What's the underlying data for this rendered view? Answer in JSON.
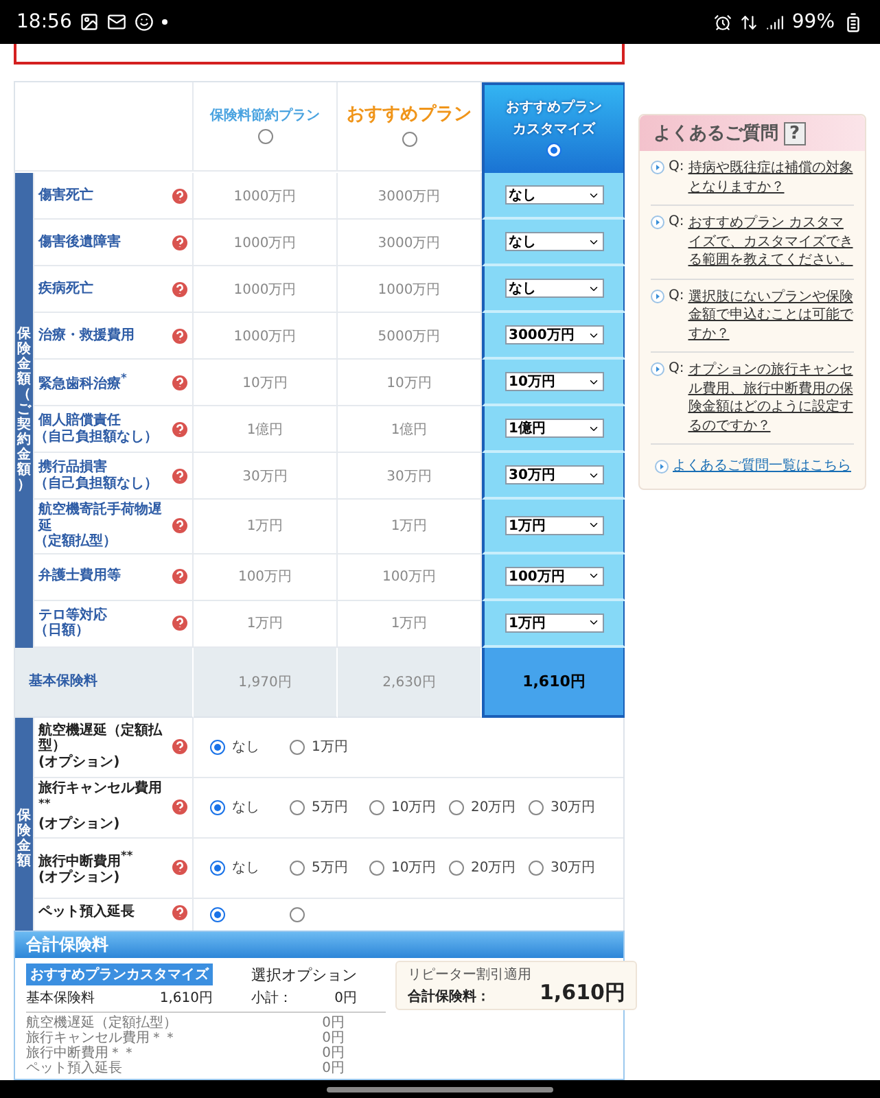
{
  "status_bar": {
    "time": "18:56",
    "battery": "99%"
  },
  "plans": [
    {
      "name": "保険料節約プラン",
      "kind": "fixed",
      "selected": false
    },
    {
      "name": "おすすめプラン",
      "kind": "fixed",
      "selected": false
    },
    {
      "name": "おすすめプラン",
      "subtitle": "カスタマイズ",
      "kind": "custom",
      "selected": true
    }
  ],
  "coverage": {
    "section_label": "保険金額（ご契約金額）",
    "rows": [
      {
        "label": "傷害死亡",
        "values": [
          "1000万円",
          "3000万円",
          "なし"
        ]
      },
      {
        "label": "傷害後遺障害",
        "values": [
          "1000万円",
          "3000万円",
          "なし"
        ]
      },
      {
        "label": "疾病死亡",
        "values": [
          "1000万円",
          "1000万円",
          "なし"
        ]
      },
      {
        "label": "治療・救援費用",
        "values": [
          "1000万円",
          "5000万円",
          "3000万円"
        ]
      },
      {
        "label": "緊急歯科治療$^{*}$",
        "values": [
          "10万円",
          "10万円",
          "10万円"
        ]
      },
      {
        "label": "個人賠償責任",
        "note": "（自己負担額なし）",
        "values": [
          "1億円",
          "1億円",
          "1億円"
        ]
      },
      {
        "label": "携行品損害",
        "note": "（自己負担額なし）",
        "values": [
          "30万円",
          "30万円",
          "30万円"
        ]
      },
      {
        "label": "航空機寄託手荷物遅延",
        "note": "（定額払型）",
        "values": [
          "1万円",
          "1万円",
          "1万円"
        ]
      },
      {
        "label": "弁護士費用等",
        "values": [
          "100万円",
          "100万円",
          "100万円"
        ]
      },
      {
        "label": "テロ等対応",
        "note": "（日額）",
        "values": [
          "1万円",
          "1万円",
          "1万円"
        ]
      }
    ]
  },
  "basic_premium": {
    "label": "基本保険料",
    "values": [
      "1,970円",
      "2,630円",
      "1,610円"
    ]
  },
  "options": {
    "section_label": "保険金額",
    "rows": [
      {
        "label": "航空機遅延（定額払型）",
        "tag": "(オプション)",
        "choices": [
          {
            "label": "なし",
            "selected": true
          },
          {
            "label": "1万円",
            "selected": false
          }
        ]
      },
      {
        "label": "旅行キャンセル費用$^{**}$",
        "tag": "(オプション)",
        "choices": [
          {
            "label": "なし",
            "selected": true
          },
          {
            "label": "5万円",
            "selected": false
          },
          {
            "label": "10万円",
            "selected": false
          },
          {
            "label": "20万円",
            "selected": false
          },
          {
            "label": "30万円",
            "selected": false
          }
        ]
      },
      {
        "label": "旅行中断費用$^{**}$",
        "tag": "(オプション)",
        "choices": [
          {
            "label": "なし",
            "selected": true
          },
          {
            "label": "5万円",
            "selected": false
          },
          {
            "label": "10万円",
            "selected": false
          },
          {
            "label": "20万円",
            "selected": false
          },
          {
            "label": "30万円",
            "selected": false
          }
        ]
      },
      {
        "label": "ペット預入延長",
        "choices": [
          {
            "selected": true
          },
          {
            "selected": false
          }
        ]
      }
    ]
  },
  "faq": {
    "title": "よくあるご質問",
    "title_icon": "?",
    "items": [
      {
        "prefix": "Q:",
        "question": "持病や既往症は補償の対象となりますか？"
      },
      {
        "prefix": "Q:",
        "question": "おすすめプラン カスタマイズで、カスタマイズできる範囲を教えてください。"
      },
      {
        "prefix": "Q:",
        "question": "選択肢にないプランや保険金額で申込むことは可能ですか？"
      },
      {
        "prefix": "Q:",
        "question": "オプションの旅行キャンセル費用、旅行中断費用の保険金額はどのように設定するのですか？"
      }
    ],
    "more_link": "よくあるご質問一覧はこちら"
  },
  "total": {
    "title": "合計保険料",
    "plan_badge": "おすすめプランカスタマイズ",
    "basic_label": "基本保険料",
    "basic_value": "1,610円",
    "options_label": "選択オプション",
    "subtotal_label": "小計：",
    "subtotal_value": "0円",
    "discount_note": "リピーター割引適用",
    "total_label": "合計保険料：",
    "total_value": "1,610円",
    "breakdown": [
      {
        "label": "航空機遅延（定額払型）",
        "value": "0円"
      },
      {
        "label": "旅行キャンセル費用＊＊",
        "value": "0円"
      },
      {
        "label": "旅行中断費用＊＊",
        "value": "0円"
      },
      {
        "label": "ペット預入延長",
        "value": "0円"
      }
    ]
  }
}
